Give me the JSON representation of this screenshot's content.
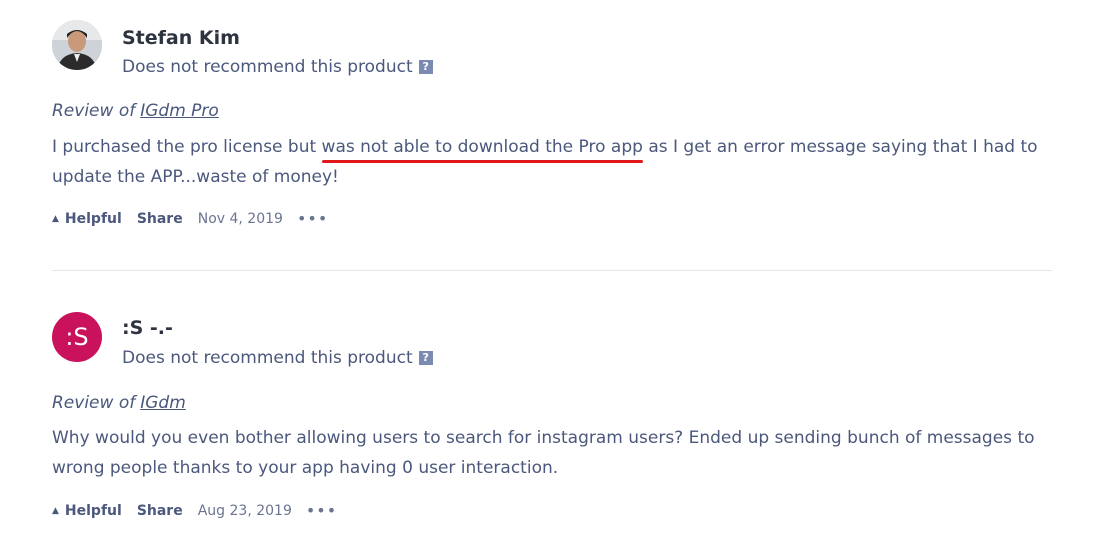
{
  "reviews": [
    {
      "reviewer_name": "Stefan Kim",
      "avatar": "photo",
      "recommendation": "Does not recommend this product",
      "help_icon": "?",
      "review_of_prefix": "Review of",
      "product": "IGdm Pro",
      "text_before": "I purchased the pro license but ",
      "text_highlight": "was not able to download the Pro app",
      "text_after": " as I get an error message saying that I had to update the APP...waste of money!",
      "helpful_label": "Helpful",
      "share_label": "Share",
      "date": "Nov 4, 2019",
      "more": "•••"
    },
    {
      "reviewer_name": ":S -.-",
      "avatar_initials": ":S",
      "recommendation": "Does not recommend this product",
      "help_icon": "?",
      "review_of_prefix": "Review of",
      "product": "IGdm",
      "text_before": "Why would you even bother allowing users to search for instagram users? ",
      "text_highlight": "Ended up sending bunch of messages to wrong people",
      "text_after": " thanks to your app having 0 user interaction.",
      "helpful_label": "Helpful",
      "share_label": "Share",
      "date": "Aug 23, 2019",
      "more": "•••"
    }
  ],
  "colors": {
    "highlight_line": "#e0181c",
    "avatar_bg": "#c9115c",
    "text": "#4b587c"
  }
}
